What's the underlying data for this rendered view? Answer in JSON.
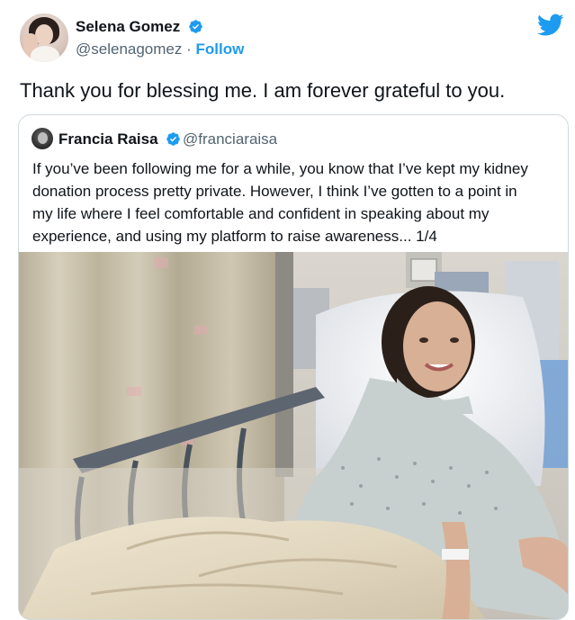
{
  "tweet": {
    "author_name": "Selena Gomez",
    "author_handle": "@selenagomez",
    "separator": " · ",
    "follow_label": "Follow",
    "text": "Thank you for blessing me. I am forever grateful to you."
  },
  "quoted": {
    "author_name": "Francia Raisa",
    "author_handle": "@franciaraisa",
    "text_lines": [
      "If you’ve been following me for a while, you know that I’ve kept my kidney",
      "donation process pretty private. However, I think I’ve gotten to a point in",
      "my life where I feel comfortable and confident in speaking about my",
      "experience, and using my platform to raise awareness... 1/4"
    ]
  },
  "icons": {
    "verified": "verified-badge-icon",
    "brand": "twitter-bird-icon"
  },
  "colors": {
    "brand_blue": "#1d9bf0",
    "text_primary": "#0f1419",
    "text_secondary": "#536471",
    "border": "#cfd9de"
  }
}
